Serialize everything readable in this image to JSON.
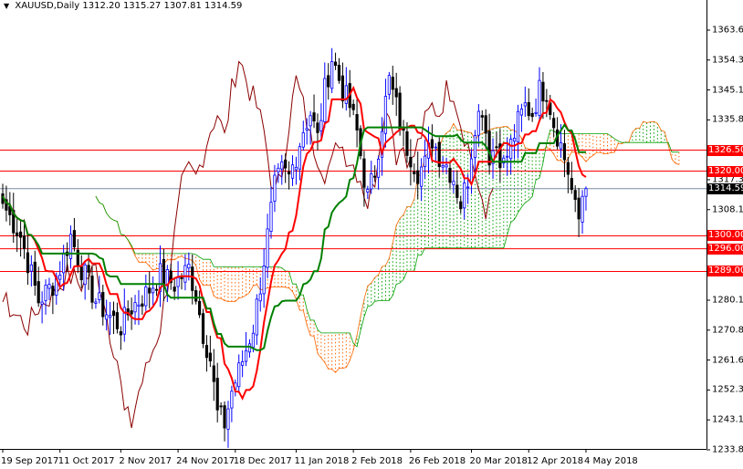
{
  "header": {
    "symbol": "XAUUSD,Daily",
    "open": "1312.20",
    "high": "1315.27",
    "low": "1307.81",
    "close": "1314.59"
  },
  "colors": {
    "bull": "#0000ff",
    "bear": "#000000",
    "tenkan": "#ff0000",
    "kijun": "#008000",
    "chikou": "#8b0000",
    "cloud_up": "#00a000",
    "cloud_down": "#ff6600",
    "level": "#ff0000",
    "bid": "#7a8ba0"
  },
  "chart_data": {
    "type": "candlestick",
    "title": "XAUUSD,Daily",
    "ylim": [
      1233.85,
      1363.6
    ],
    "y_ticks": [
      "1363.60",
      "1354.35",
      "1345.10",
      "1335.85",
      "1317.35",
      "1308.10",
      "1280.10",
      "1270.85",
      "1261.60",
      "1252.35",
      "1243.10",
      "1233.85"
    ],
    "x_ticks": [
      {
        "bar": 0,
        "label": "19 Sep 2017"
      },
      {
        "bar": 16,
        "label": "11 Oct 2017"
      },
      {
        "bar": 33,
        "label": "2 Nov 2017"
      },
      {
        "bar": 49,
        "label": "24 Nov 2017"
      },
      {
        "bar": 65,
        "label": "18 Dec 2017"
      },
      {
        "bar": 82,
        "label": "11 Jan 2018"
      },
      {
        "bar": 98,
        "label": "2 Feb 2018"
      },
      {
        "bar": 114,
        "label": "26 Feb 2018"
      },
      {
        "bar": 131,
        "label": "20 Mar 2018"
      },
      {
        "bar": 147,
        "label": "12 Apr 2018"
      },
      {
        "bar": 163,
        "label": "4 May 2018"
      }
    ],
    "close_path": [
      [
        0,
        1310
      ],
      [
        5,
        1300
      ],
      [
        10,
        1280
      ],
      [
        14,
        1285
      ],
      [
        16,
        1290
      ],
      [
        19,
        1300
      ],
      [
        22,
        1290
      ],
      [
        26,
        1280
      ],
      [
        30,
        1275
      ],
      [
        33,
        1272
      ],
      [
        36,
        1278
      ],
      [
        40,
        1282
      ],
      [
        44,
        1288
      ],
      [
        48,
        1285
      ],
      [
        52,
        1290
      ],
      [
        54,
        1282
      ],
      [
        56,
        1270
      ],
      [
        58,
        1262
      ],
      [
        60,
        1245
      ],
      [
        62,
        1242
      ],
      [
        64,
        1252
      ],
      [
        66,
        1258
      ],
      [
        68,
        1265
      ],
      [
        70,
        1272
      ],
      [
        72,
        1285
      ],
      [
        74,
        1300
      ],
      [
        76,
        1315
      ],
      [
        78,
        1320
      ],
      [
        80,
        1318
      ],
      [
        82,
        1325
      ],
      [
        84,
        1333
      ],
      [
        86,
        1338
      ],
      [
        88,
        1330
      ],
      [
        90,
        1345
      ],
      [
        92,
        1355
      ],
      [
        93,
        1352
      ],
      [
        95,
        1345
      ],
      [
        97,
        1340
      ],
      [
        99,
        1332
      ],
      [
        101,
        1318
      ],
      [
        102,
        1312
      ],
      [
        104,
        1320
      ],
      [
        106,
        1335
      ],
      [
        108,
        1348
      ],
      [
        110,
        1340
      ],
      [
        112,
        1330
      ],
      [
        114,
        1325
      ],
      [
        116,
        1320
      ],
      [
        118,
        1322
      ],
      [
        120,
        1330
      ],
      [
        122,
        1325
      ],
      [
        124,
        1322
      ],
      [
        126,
        1318
      ],
      [
        128,
        1310
      ],
      [
        130,
        1318
      ],
      [
        132,
        1335
      ],
      [
        134,
        1340
      ],
      [
        136,
        1325
      ],
      [
        138,
        1328
      ],
      [
        140,
        1322
      ],
      [
        142,
        1328
      ],
      [
        144,
        1335
      ],
      [
        146,
        1340
      ],
      [
        148,
        1338
      ],
      [
        150,
        1345
      ],
      [
        152,
        1345
      ],
      [
        154,
        1335
      ],
      [
        156,
        1328
      ],
      [
        158,
        1320
      ],
      [
        160,
        1308
      ],
      [
        161,
        1305
      ],
      [
        162,
        1312.2
      ],
      [
        163,
        1314.59
      ]
    ],
    "last_bar": {
      "open": 1312.2,
      "high": 1315.27,
      "low": 1307.81,
      "close": 1314.59
    },
    "levels": [
      {
        "value": 1326.5,
        "label": "1326.50"
      },
      {
        "value": 1320.0,
        "label": "1320.00"
      },
      {
        "value": 1300.0,
        "label": "1300.00"
      },
      {
        "value": 1296.0,
        "label": "1296.00"
      },
      {
        "value": 1289.0,
        "label": "1289.00"
      }
    ],
    "current_price": {
      "value": 1314.59,
      "label": "1314.59"
    },
    "indicators": {
      "ichimoku": {
        "tenkan": 9,
        "kijun": 26,
        "senkou_b": 52
      }
    }
  }
}
